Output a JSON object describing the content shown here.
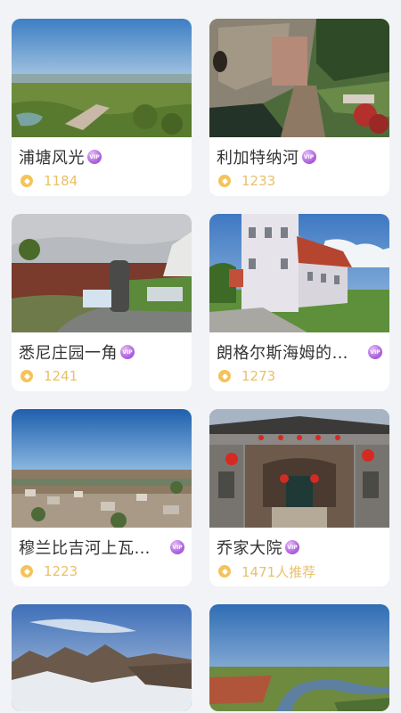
{
  "cards": [
    {
      "title": "浦塘风光",
      "count": "1184",
      "vip_text": "VIP"
    },
    {
      "title": "利加特纳河",
      "count": "1233",
      "vip_text": "VIP"
    },
    {
      "title": "悉尼庄园一角",
      "count": "1241",
      "vip_text": "VIP"
    },
    {
      "title": "朗格尔斯海姆的…",
      "count": "1273",
      "vip_text": "VIP"
    },
    {
      "title": "穆兰比吉河上瓦…",
      "count": "1223",
      "vip_text": "VIP"
    },
    {
      "title": "乔家大院",
      "count": "1471人推荐",
      "vip_text": "VIP"
    }
  ],
  "icons": {
    "badge": "vip-badge-icon",
    "coin": "coin-icon"
  },
  "colors": {
    "background": "#f2f3f6",
    "title": "#333333",
    "count": "#e9c06a",
    "coin": "#f4c45a",
    "vip": "#b46be0"
  }
}
